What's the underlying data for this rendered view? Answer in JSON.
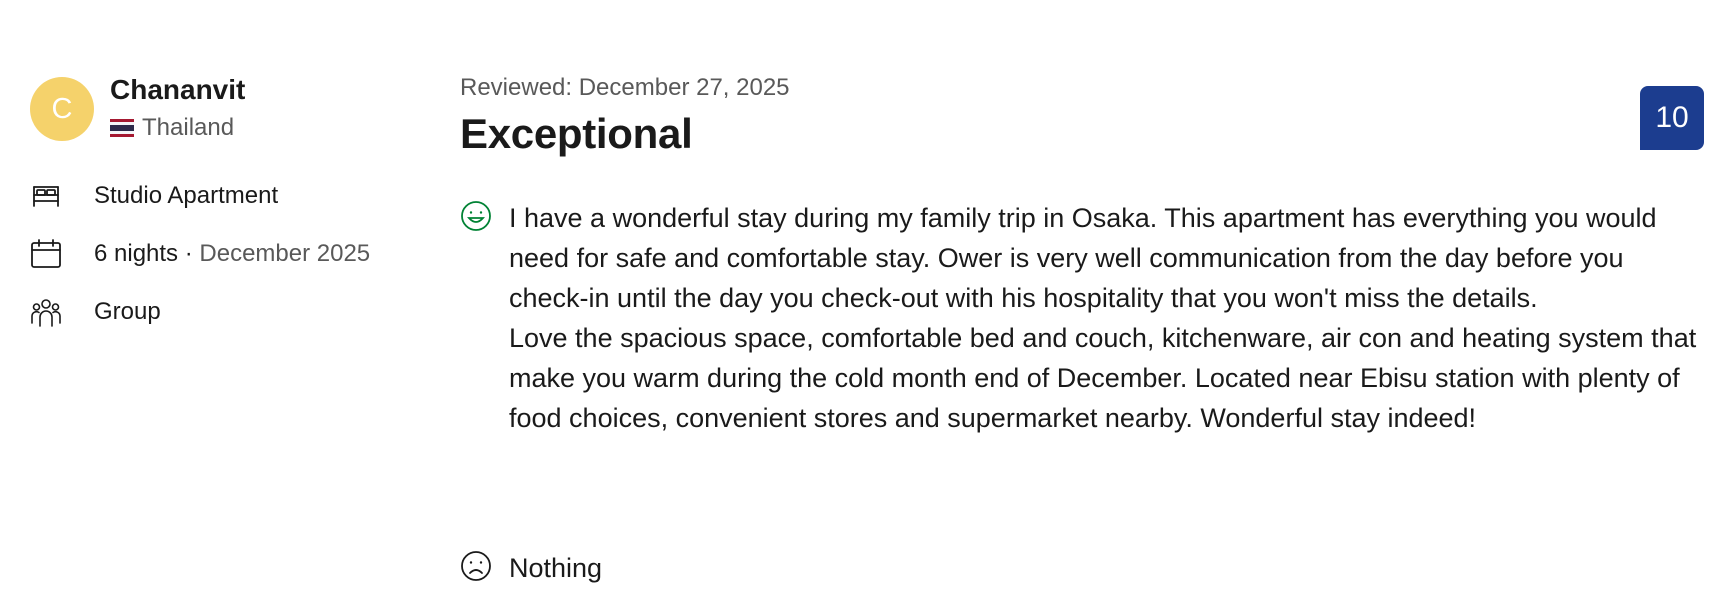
{
  "reviewer": {
    "avatar_initial": "C",
    "name": "Chananvit",
    "country": "Thailand",
    "avatar_color": "#f5d26b"
  },
  "stay_details": {
    "room_type": "Studio Apartment",
    "nights": "6 nights",
    "separator": " · ",
    "month": "December 2025",
    "traveler_type": "Group",
    "icons": [
      "bed-icon",
      "calendar-icon",
      "group-icon"
    ]
  },
  "review": {
    "date": "Reviewed: December 27, 2025",
    "title": "Exceptional",
    "score": "10",
    "score_color": "#1c3d8f",
    "positive_text": "I have a wonderful stay during my family trip in Osaka. This apartment has everything you would need for safe and comfortable stay. Ower is very well communication from the day before you check-in until the day you check-out with his hospitality that you won't miss the details.\nLove the spacious space, comfortable bed and couch, kitchenware, air con and heating system that make you warm during the cold month end of December. Located near Ebisu station with plenty of food choices, convenient stores and supermarket nearby. Wonderful stay indeed!",
    "negative_text": "Nothing",
    "positive_icon_color": "#008234"
  }
}
